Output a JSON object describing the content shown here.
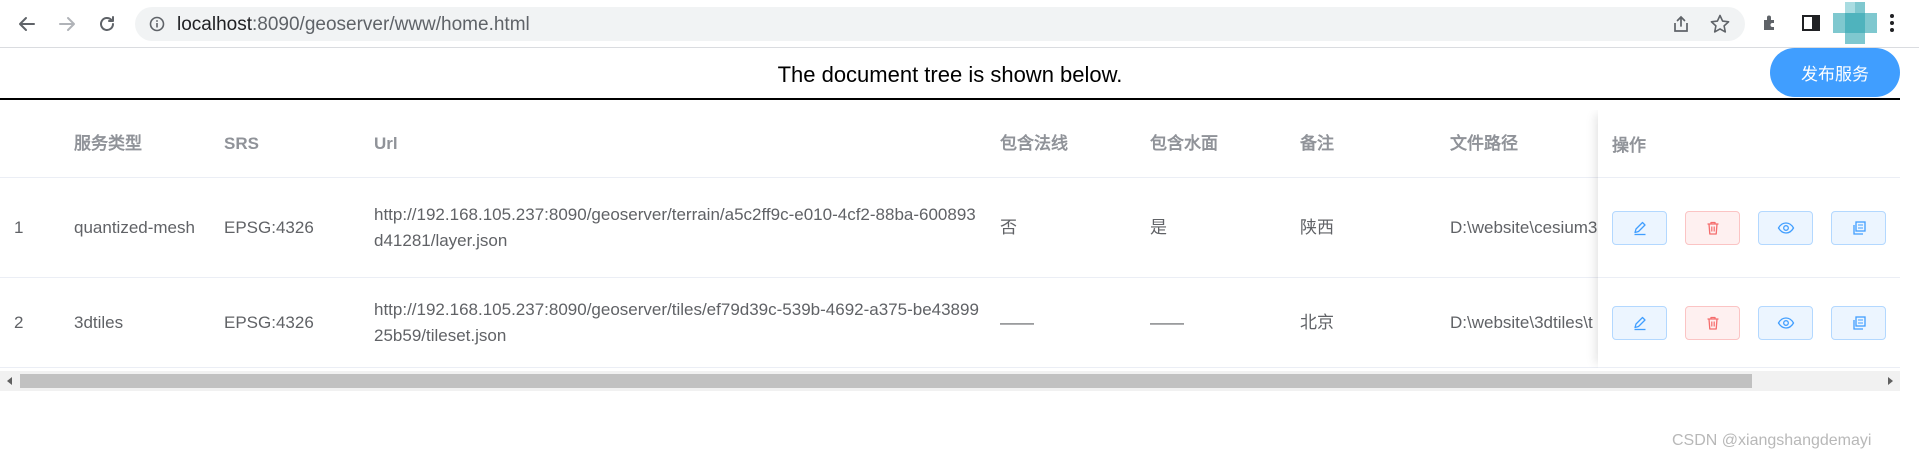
{
  "browser": {
    "url_host": "localhost",
    "url_rest": ":8090/geoserver/www/home.html",
    "icons": [
      "back-icon",
      "forward-icon",
      "reload-icon",
      "info-icon",
      "share-icon",
      "star-icon",
      "extensions-icon",
      "sidepanel-icon",
      "profile-avatar",
      "menu-icon"
    ]
  },
  "page": {
    "doc_note": "The document tree is shown below.",
    "publish_label": "发布服务"
  },
  "table": {
    "headers": {
      "type": "服务类型",
      "srs": "SRS",
      "url": "Url",
      "normal": "包含法线",
      "water": "包含水面",
      "note": "备注",
      "path": "文件路径",
      "ops": "操作"
    },
    "rows": [
      {
        "idx": "1",
        "type": "quantized-mesh",
        "srs": "EPSG:4326",
        "url": "http://192.168.105.237:8090/geoserver/terrain/a5c2ff9c-e010-4cf2-88ba-600893d41281/layer.json",
        "normal": "否",
        "water": "是",
        "note": "陕西",
        "path": "D:\\website\\cesium3"
      },
      {
        "idx": "2",
        "type": "3dtiles",
        "srs": "EPSG:4326",
        "url": "http://192.168.105.237:8090/geoserver/tiles/ef79d39c-539b-4692-a375-be4389925b59/tileset.json",
        "normal": "——",
        "water": "——",
        "note": "北京",
        "path": "D:\\website\\3dtiles\\t"
      }
    ]
  },
  "watermark": "CSDN @xiangshangdemayi",
  "colors": {
    "primary": "#409eff",
    "danger": "#f56c6c",
    "header_text": "#909399",
    "body_text": "#606266"
  }
}
